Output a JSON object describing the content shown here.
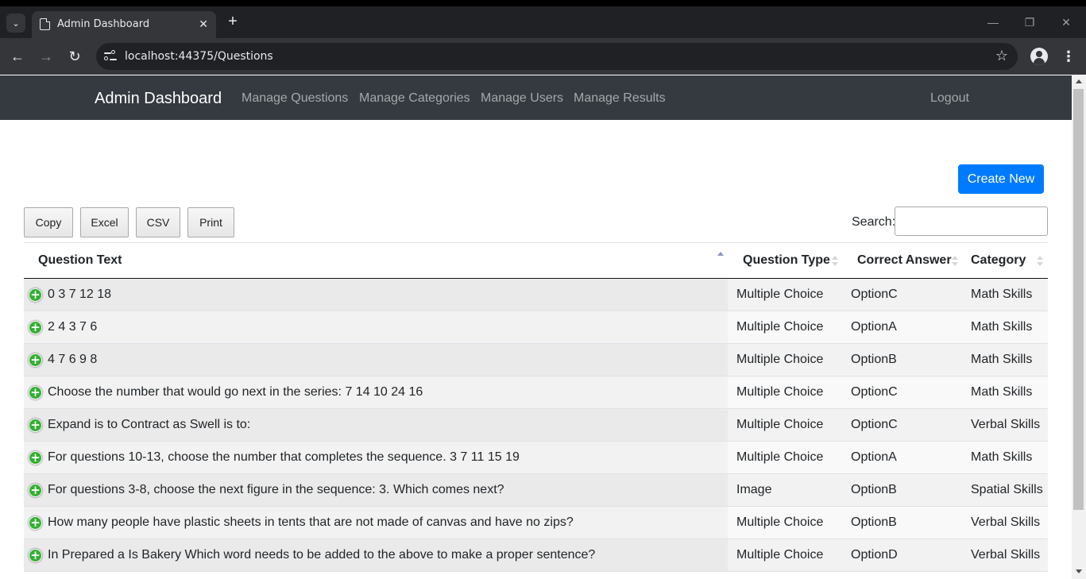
{
  "browser": {
    "tab_title": "Admin Dashboard",
    "tab_close": "✕",
    "new_tab": "+",
    "url": "localhost:44375/Questions",
    "icons": {
      "tab_list": "chevron-down-icon",
      "back": "arrow-left-icon",
      "forward": "arrow-right-icon",
      "reload": "reload-icon",
      "site_info": "tune-icon",
      "bookmark": "star-icon",
      "profile": "profile-icon",
      "menu": "kebab-icon",
      "minimize": "minimize-icon",
      "restore": "restore-icon",
      "close": "close-icon"
    }
  },
  "navbar": {
    "brand": "Admin Dashboard",
    "links": [
      "Manage Questions",
      "Manage Categories",
      "Manage Users",
      "Manage Results"
    ],
    "logout": "Logout"
  },
  "actions": {
    "create_new": "Create New",
    "export_buttons": [
      "Copy",
      "Excel",
      "CSV",
      "Print"
    ],
    "search_label": "Search:",
    "search_value": ""
  },
  "table": {
    "columns": [
      "Question Text",
      "Question Type",
      "Correct Answer",
      "Category"
    ],
    "sorted_column": "Question Text",
    "sort_direction": "ascending",
    "rows": [
      {
        "text": "0 3 7 12 18",
        "type": "Multiple Choice",
        "answer": "OptionC",
        "category": "Math Skills"
      },
      {
        "text": "2 4 3 7 6",
        "type": "Multiple Choice",
        "answer": "OptionA",
        "category": "Math Skills"
      },
      {
        "text": "4 7 6 9 8",
        "type": "Multiple Choice",
        "answer": "OptionB",
        "category": "Math Skills"
      },
      {
        "text": "Choose the number that would go next in the series: 7 14 10 24 16",
        "type": "Multiple Choice",
        "answer": "OptionC",
        "category": "Math Skills"
      },
      {
        "text": "Expand is to Contract as Swell is to:",
        "type": "Multiple Choice",
        "answer": "OptionC",
        "category": "Verbal Skills"
      },
      {
        "text": "For questions 10-13, choose the number that completes the sequence. 3 7 11 15 19",
        "type": "Multiple Choice",
        "answer": "OptionA",
        "category": "Math Skills"
      },
      {
        "text": "For questions 3-8, choose the next figure in the sequence: 3. Which comes next?",
        "type": "Image",
        "answer": "OptionB",
        "category": "Spatial Skills"
      },
      {
        "text": "How many people have plastic sheets in tents that are not made of canvas and have no zips?",
        "type": "Multiple Choice",
        "answer": "OptionB",
        "category": "Verbal Skills"
      },
      {
        "text": "In Prepared a Is Bakery Which word needs to be added to the above to make a proper sentence?",
        "type": "Multiple Choice",
        "answer": "OptionD",
        "category": "Verbal Skills"
      }
    ],
    "expand_icon": "plus-circle-icon"
  },
  "colors": {
    "navbar_bg": "#343a40",
    "primary": "#007bff",
    "expand_green": "#31b131"
  }
}
